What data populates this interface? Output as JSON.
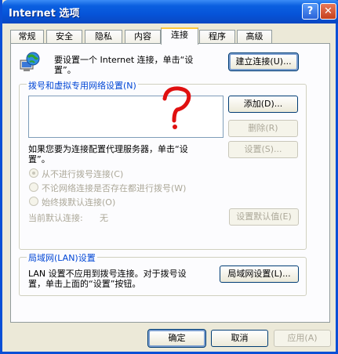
{
  "window": {
    "title": "Internet 选项",
    "help_label": "?",
    "close_label": "✕"
  },
  "tabs": [
    {
      "label": "常规"
    },
    {
      "label": "安全"
    },
    {
      "label": "隐私"
    },
    {
      "label": "内容"
    },
    {
      "label": "连接"
    },
    {
      "label": "程序"
    },
    {
      "label": "高级"
    }
  ],
  "setup": {
    "text_line1": "要设置一个 Internet 连接，单击“设",
    "text_line2": "置”。",
    "button": "建立连接(U)..."
  },
  "dialup": {
    "group_title": "拨号和虚拟专用网络设置(N)",
    "add_button": "添加(D)...",
    "remove_button": "删除(R)",
    "settings_button": "设置(S)...",
    "proxy_line1": "如果您要为连接配置代理服务器，单击“设",
    "proxy_line2": "置”。",
    "radio_never": "从不进行拨号连接(C)",
    "radio_whenever": "不论网络连接是否存在都进行拨号(W)",
    "radio_always": "始终拨默认连接(O)",
    "current_default_label": "当前默认连接:",
    "current_default_value": "无",
    "set_default_button": "设置默认值(E)",
    "annotation": "?"
  },
  "lan": {
    "group_title": "局域网(LAN)设置",
    "text_line1": "LAN 设置不应用到拨号连接。对于拨号设",
    "text_line2": "置，单击上面的“设置”按钮。",
    "button": "局域网设置(L)..."
  },
  "footer": {
    "ok": "确定",
    "cancel": "取消",
    "apply": "应用(A)"
  },
  "colors": {
    "titlebar": "#0a5fe0",
    "annotation": "#e01010",
    "group_title": "#0046d5"
  }
}
